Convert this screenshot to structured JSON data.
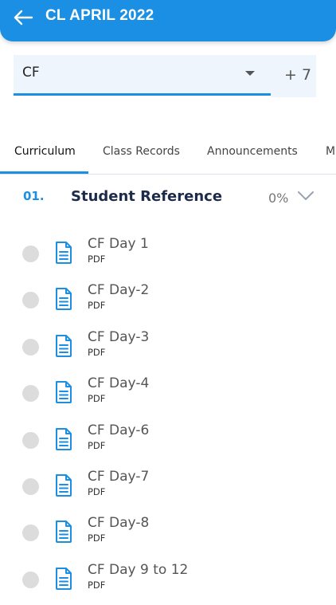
{
  "header": {
    "title": "CL APRIL 2022",
    "back_icon": "arrow-left-icon"
  },
  "selector": {
    "value": "CF",
    "more_label": "+ 7"
  },
  "tabs": [
    {
      "label": "Curriculum",
      "active": true
    },
    {
      "label": "Class Records",
      "active": false
    },
    {
      "label": "Announcements",
      "active": false
    },
    {
      "label": "M",
      "active": false
    }
  ],
  "section": {
    "number": "01.",
    "title": "Student Reference",
    "progress": "0%"
  },
  "items": [
    {
      "title": "CF Day 1",
      "type": "PDF"
    },
    {
      "title": "CF Day-2",
      "type": "PDF"
    },
    {
      "title": "CF Day-3",
      "type": "PDF"
    },
    {
      "title": "CF Day-4",
      "type": "PDF"
    },
    {
      "title": "CF Day-6",
      "type": "PDF"
    },
    {
      "title": "CF Day-7",
      "type": "PDF"
    },
    {
      "title": "CF Day-8",
      "type": "PDF"
    },
    {
      "title": "CF Day 9 to 12",
      "type": "PDF"
    }
  ],
  "colors": {
    "accent": "#1a8fe3",
    "header_bg": "#1a8fe3",
    "select_bg": "#eef5fc",
    "radio": "#dcdcdc"
  }
}
